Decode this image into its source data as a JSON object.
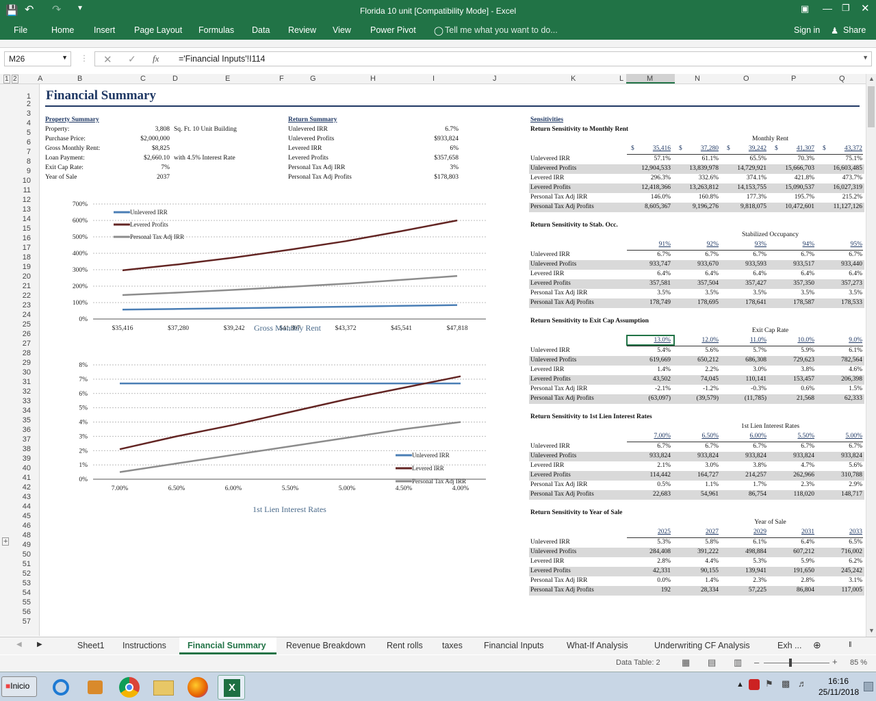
{
  "window": {
    "title": "Florida 10 unit  [Compatibility Mode] - Excel"
  },
  "ribbon": {
    "tabs": [
      "File",
      "Home",
      "Insert",
      "Page Layout",
      "Formulas",
      "Data",
      "Review",
      "View",
      "Power Pivot"
    ],
    "tell_me": "Tell me what you want to do...",
    "sign_in": "Sign in",
    "share": "Share"
  },
  "formula_bar": {
    "cell": "M26",
    "formula": "='Financial Inputs'!I114"
  },
  "columns": [
    "A",
    "B",
    "C",
    "D",
    "E",
    "F",
    "G",
    "H",
    "I",
    "J",
    "K",
    "L",
    "M",
    "N",
    "O",
    "P",
    "Q"
  ],
  "rows": [
    "1",
    "2",
    "3",
    "4",
    "5",
    "6",
    "7",
    "8",
    "9",
    "10",
    "11",
    "12",
    "13",
    "14",
    "15",
    "16",
    "17",
    "18",
    "19",
    "20",
    "21",
    "22",
    "23",
    "24",
    "25",
    "26",
    "27",
    "28",
    "29",
    "30",
    "31",
    "32",
    "33",
    "34",
    "35",
    "36",
    "37",
    "38",
    "39",
    "40",
    "41",
    "42",
    "43",
    "44",
    "45",
    "46",
    "48",
    "49",
    "50",
    "51",
    "52",
    "53",
    "54",
    "55",
    "56",
    "57"
  ],
  "summary": {
    "title": "Financial Summary",
    "property_header": "Property Summary",
    "property": [
      [
        "Property:",
        "3,808",
        "Sq. Ft. 10 Unit Building"
      ],
      [
        "Purchase Price:",
        "$2,000,000",
        ""
      ],
      [
        "Gross Monthly Rent:",
        "$8,825",
        ""
      ],
      [
        "Loan Payment:",
        "$2,660.10",
        "with 4.5% Interest Rate"
      ],
      [
        "Exit Cap Rate:",
        "7%",
        ""
      ],
      [
        "Year of Sale",
        "2037",
        ""
      ]
    ],
    "return_header": "Return Summary",
    "returns": [
      [
        "Unlevered IRR",
        "6.7%"
      ],
      [
        "Unlevered Profits",
        "$933,824"
      ],
      [
        "Levered IRR",
        "6%"
      ],
      [
        "Levered Profits",
        "$357,658"
      ],
      [
        "Personal Tax Adj IRR",
        "3%"
      ],
      [
        "Personal Tax Adj Profits",
        "$178,803"
      ]
    ]
  },
  "sensitivities": {
    "header": "Sensitivities",
    "row_labels": [
      "Unlevered IRR",
      "Unlevered Profits",
      "Levered IRR",
      "Levered Profits",
      "Personal Tax Adj IRR",
      "Personal Tax Adj Profits"
    ],
    "blocks": [
      {
        "title": "Return Sensitivity to Monthly Rent",
        "axis": "Monthly Rent",
        "cols": [
          "35,416",
          "37,280",
          "39,242",
          "41,307",
          "43,372"
        ],
        "dollar": "$",
        "rows": [
          [
            "57.1%",
            "61.1%",
            "65.5%",
            "70.3%",
            "75.1%"
          ],
          [
            "12,904,533",
            "13,839,978",
            "14,729,921",
            "15,666,703",
            "16,603,485"
          ],
          [
            "296.3%",
            "332.6%",
            "374.1%",
            "421.8%",
            "473.7%"
          ],
          [
            "12,418,366",
            "13,263,812",
            "14,153,755",
            "15,090,537",
            "16,027,319"
          ],
          [
            "146.0%",
            "160.8%",
            "177.3%",
            "195.7%",
            "215.2%"
          ],
          [
            "8,605,367",
            "9,196,276",
            "9,818,075",
            "10,472,601",
            "11,127,126"
          ]
        ]
      },
      {
        "title": "Return Sensitivity to Stab. Occ.",
        "axis": "Stabilized Occupancy",
        "cols": [
          "91%",
          "92%",
          "93%",
          "94%",
          "95%"
        ],
        "dollar": "",
        "rows": [
          [
            "6.7%",
            "6.7%",
            "6.7%",
            "6.7%",
            "6.7%"
          ],
          [
            "933,747",
            "933,670",
            "933,593",
            "933,517",
            "933,440"
          ],
          [
            "6.4%",
            "6.4%",
            "6.4%",
            "6.4%",
            "6.4%"
          ],
          [
            "357,581",
            "357,504",
            "357,427",
            "357,350",
            "357,273"
          ],
          [
            "3.5%",
            "3.5%",
            "3.5%",
            "3.5%",
            "3.5%"
          ],
          [
            "178,749",
            "178,695",
            "178,641",
            "178,587",
            "178,533"
          ]
        ]
      },
      {
        "title": "Return Sensitivity to Exit Cap Assumption",
        "axis": "Exit Cap Rate",
        "cols": [
          "13.0%",
          "12.0%",
          "11.0%",
          "10.0%",
          "9.0%"
        ],
        "dollar": "",
        "rows": [
          [
            "5.4%",
            "5.6%",
            "5.7%",
            "5.9%",
            "6.1%"
          ],
          [
            "619,669",
            "650,212",
            "686,308",
            "729,623",
            "782,564"
          ],
          [
            "1.4%",
            "2.2%",
            "3.0%",
            "3.8%",
            "4.6%"
          ],
          [
            "43,502",
            "74,045",
            "110,141",
            "153,457",
            "206,398"
          ],
          [
            "-2.1%",
            "-1.2%",
            "-0.3%",
            "0.6%",
            "1.5%"
          ],
          [
            "(63,097)",
            "(39,579)",
            "(11,785)",
            "21,568",
            "62,333"
          ]
        ]
      },
      {
        "title": "Return Sensitivity to 1st Lien Interest Rates",
        "axis": "1st Lien Interest Rates",
        "cols": [
          "7.00%",
          "6.50%",
          "6.00%",
          "5.50%",
          "5.00%"
        ],
        "dollar": "",
        "rows": [
          [
            "6.7%",
            "6.7%",
            "6.7%",
            "6.7%",
            "6.7%"
          ],
          [
            "933,824",
            "933,824",
            "933,824",
            "933,824",
            "933,824"
          ],
          [
            "2.1%",
            "3.0%",
            "3.8%",
            "4.7%",
            "5.6%"
          ],
          [
            "114,442",
            "164,727",
            "214,257",
            "262,966",
            "310,788"
          ],
          [
            "0.5%",
            "1.1%",
            "1.7%",
            "2.3%",
            "2.9%"
          ],
          [
            "22,683",
            "54,961",
            "86,754",
            "118,020",
            "148,717"
          ]
        ]
      },
      {
        "title": "Return Sensitivity to Year of Sale",
        "axis": "Year of Sale",
        "cols": [
          "2025",
          "2027",
          "2029",
          "2031",
          "2033"
        ],
        "dollar": "",
        "rows": [
          [
            "5.3%",
            "5.8%",
            "6.1%",
            "6.4%",
            "6.5%"
          ],
          [
            "284,408",
            "391,222",
            "498,884",
            "607,212",
            "716,002"
          ],
          [
            "2.8%",
            "4.4%",
            "5.3%",
            "5.9%",
            "6.2%"
          ],
          [
            "42,331",
            "90,155",
            "139,941",
            "191,650",
            "245,242"
          ],
          [
            "0.0%",
            "1.4%",
            "2.3%",
            "2.8%",
            "3.1%"
          ],
          [
            "192",
            "28,334",
            "57,225",
            "86,804",
            "117,005"
          ]
        ]
      }
    ]
  },
  "chart_data": [
    {
      "type": "line",
      "xlabel": "Gross Monthly Rent",
      "ylim": [
        0,
        700
      ],
      "yticks": [
        "0%",
        "100%",
        "200%",
        "300%",
        "400%",
        "500%",
        "600%",
        "700%"
      ],
      "categories": [
        "$35,416",
        "$37,280",
        "$39,242",
        "$41,307",
        "$43,372",
        "$45,541",
        "$47,818"
      ],
      "series": [
        {
          "name": "Unlevered IRR",
          "color": "#4a7eb5",
          "values": [
            57.1,
            61.1,
            65.5,
            70.3,
            75.1,
            80,
            85
          ]
        },
        {
          "name": "Levered Profits",
          "color": "#632523",
          "values": [
            296.3,
            332.6,
            374.1,
            421.8,
            473.7,
            535,
            600
          ]
        },
        {
          "name": "Personal Tax Adj IRR",
          "color": "#8c8c8c",
          "values": [
            146,
            160.8,
            177.3,
            195.7,
            215.2,
            238,
            262
          ]
        }
      ]
    },
    {
      "type": "line",
      "xlabel": "1st Lien Interest Rates",
      "ylim": [
        0,
        8
      ],
      "yticks": [
        "0%",
        "1%",
        "2%",
        "3%",
        "4%",
        "5%",
        "6%",
        "7%",
        "8%"
      ],
      "categories": [
        "7.00%",
        "6.50%",
        "6.00%",
        "5.50%",
        "5.00%",
        "4.50%",
        "4.00%"
      ],
      "series": [
        {
          "name": "Unlevered IRR",
          "color": "#4a7eb5",
          "values": [
            6.7,
            6.7,
            6.7,
            6.7,
            6.7,
            6.7,
            6.7
          ]
        },
        {
          "name": "Levered IRR",
          "color": "#632523",
          "values": [
            2.1,
            3.0,
            3.8,
            4.7,
            5.6,
            6.4,
            7.2
          ]
        },
        {
          "name": "Personal Tax Adj IRR",
          "color": "#8c8c8c",
          "values": [
            0.5,
            1.1,
            1.7,
            2.3,
            2.9,
            3.5,
            4.0
          ]
        }
      ]
    }
  ],
  "sheet_tabs": [
    "Sheet1",
    "Instructions",
    "Financial Summary",
    "Revenue Breakdown",
    "Rent rolls",
    "taxes",
    "Financial Inputs",
    "What-If Analysis",
    "Underwriting CF Analysis",
    "Exh ..."
  ],
  "status": {
    "info": "Data Table: 2",
    "zoom": "85 %"
  },
  "taskbar": {
    "start": "Inicio",
    "time": "16:16",
    "date": "25/11/2018"
  }
}
